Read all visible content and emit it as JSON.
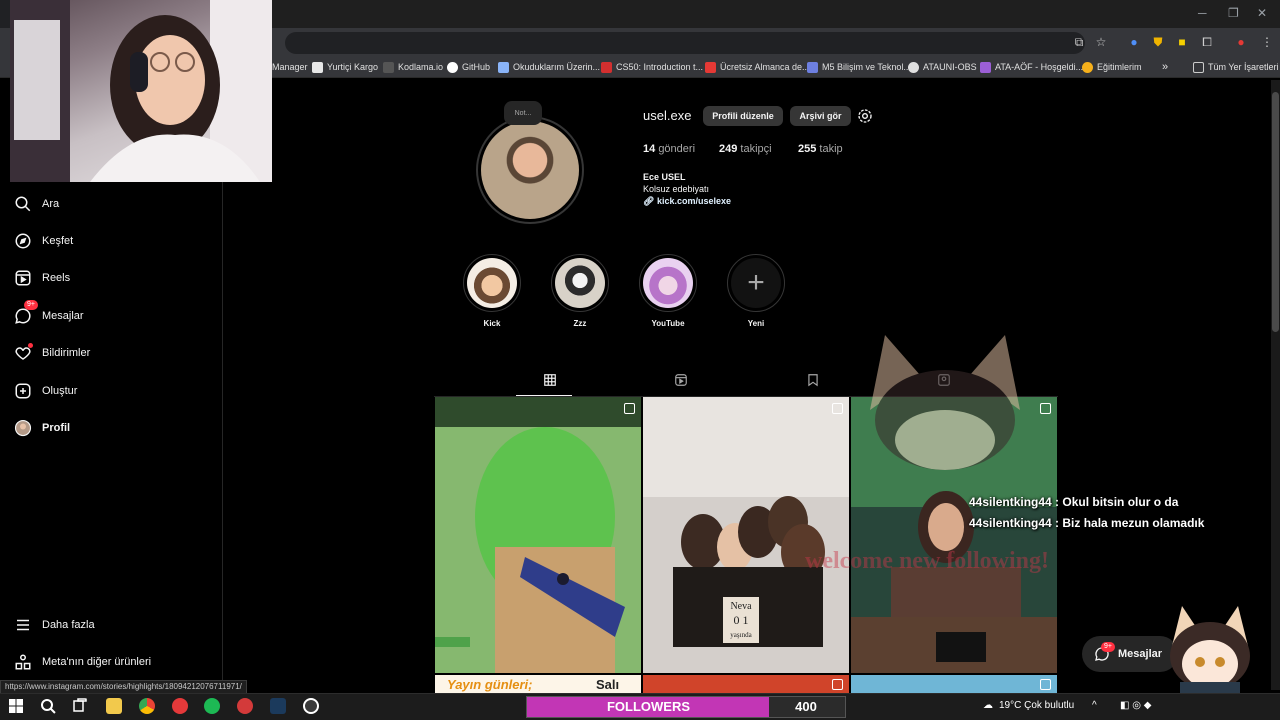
{
  "browser": {
    "bookmarks": [
      {
        "label": "Manager",
        "color": "#e8e8e8"
      },
      {
        "label": "Yurtiçi Kargo",
        "color": "#ffffff"
      },
      {
        "label": "Kodlama.io",
        "color": "#333333"
      },
      {
        "label": "GitHub",
        "color": "#ffffff"
      },
      {
        "label": "Okuduklarım Üzerin...",
        "color": "#8ab4f8"
      },
      {
        "label": "CS50: Introduction t...",
        "color": "#d32f2f"
      },
      {
        "label": "Ücretsiz Almanca de...",
        "color": "#e53935"
      },
      {
        "label": "M5 Bilişim ve Teknol...",
        "color": "#6d7fe0"
      },
      {
        "label": "ATAUNI-OBS",
        "color": "#e0e0e0"
      },
      {
        "label": "ATA-AÖF - Hoşgeldi...",
        "color": "#9c5fd6"
      },
      {
        "label": "Eğitimlerim",
        "color": "#f6b01b"
      },
      {
        "label": "»",
        "color": "transparent"
      },
      {
        "label": "Tüm Yer İşaretleri",
        "color": "transparent"
      }
    ],
    "status_url": "https://www.instagram.com/stories/highlights/18094212076711971/"
  },
  "sidebar": {
    "items": [
      {
        "label": "Ara",
        "icon": "search-icon"
      },
      {
        "label": "Keşfet",
        "icon": "compass-icon"
      },
      {
        "label": "Reels",
        "icon": "reels-icon"
      },
      {
        "label": "Mesajlar",
        "icon": "messenger-icon",
        "badge": "9+"
      },
      {
        "label": "Bildirimler",
        "icon": "heart-icon"
      },
      {
        "label": "Oluştur",
        "icon": "plus-square-icon"
      },
      {
        "label": "Profil",
        "icon": "avatar"
      }
    ],
    "more": "Daha fazla",
    "meta": "Meta'nın diğer ürünleri"
  },
  "profile": {
    "note": "Not...",
    "username": "usel.exe",
    "edit_button": "Profili düzenle",
    "archive_button": "Arşivi gör",
    "posts_count": "14",
    "posts_label": "gönderi",
    "followers_count": "249",
    "followers_label": "takipçi",
    "following_count": "255",
    "following_label": "takip",
    "full_name": "Ece USEL",
    "bio": "Kolsuz edebiyatı",
    "link": "kick.com/uselexe"
  },
  "highlights": [
    {
      "label": "Kick"
    },
    {
      "label": "Zzz"
    },
    {
      "label": "YouTube"
    },
    {
      "label": "Yeni"
    }
  ],
  "posts": {
    "first_caption": "Yayın günleri;",
    "first_caption_tail": "Salı",
    "photo_sign": "Neva",
    "photo_sign_num": "0 1",
    "photo_sign_sub": "yaşında"
  },
  "chat": [
    "44silentking44 : Okul bitsin olur o da",
    "44silentking44 : Biz hala mezun olamadık"
  ],
  "overlay_text": "welcome new following!",
  "messages_pill": {
    "label": "Mesajlar",
    "badge": "9+"
  },
  "stream_goal": {
    "label": "FOLLOWERS",
    "count": "400",
    "progress": 0.76
  },
  "taskbar": {
    "weather": "19°C  Çok bulutlu"
  }
}
